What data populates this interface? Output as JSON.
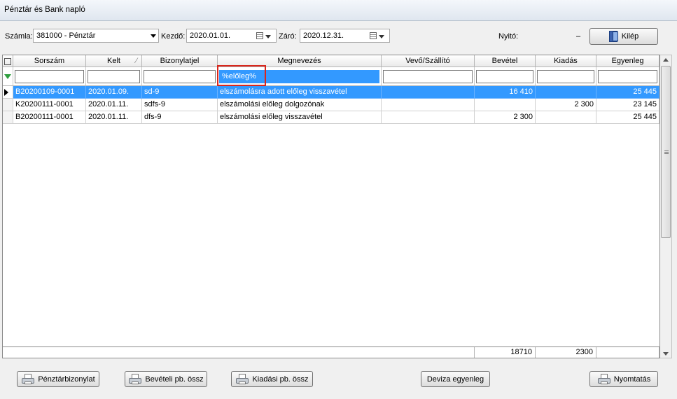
{
  "window": {
    "title": "Pénztár és Bank napló"
  },
  "toolbar": {
    "szamla_label": "Számla:",
    "szamla_value": "381000 - Pénztár",
    "kezdo_label": "Kezdő:",
    "kezdo_value": "2020.01.01.",
    "zaro_label": "Záró:",
    "zaro_value": "2020.12.31.",
    "nyito_label": "Nyitó:",
    "nyito_value": "–",
    "exit_label": "Kilép"
  },
  "grid": {
    "columns": [
      "Sorszám",
      "Kelt",
      "Bizonylatjel",
      "Megnevezés",
      "Vevő/Szállító",
      "Bevétel",
      "Kiadás",
      "Egyenleg"
    ],
    "filters": [
      "",
      "",
      "",
      "%előleg%",
      "",
      "",
      "",
      ""
    ],
    "rows": [
      [
        "B20200109-0001",
        "2020.01.09.",
        "sd-9",
        "elszámolásra adott előleg visszavétel",
        "",
        "16 410",
        "",
        "25 445"
      ],
      [
        "K20200111-0001",
        "2020.01.11.",
        "sdfs-9",
        "elszámolási előleg dolgozónak",
        "",
        "",
        "2 300",
        "23 145"
      ],
      [
        "B20200111-0001",
        "2020.01.11.",
        "dfs-9",
        "elszámolási előleg visszavétel",
        "",
        "2 300",
        "",
        "25 445"
      ]
    ],
    "totals": {
      "bevetel": "18710",
      "kiadas": "2300"
    }
  },
  "buttons": {
    "penztar": "Pénztárbizonylat",
    "beveteli": "Bevételi pb. össz",
    "kiadasi": "Kiadási pb. össz",
    "deviza": "Deviza egyenleg",
    "nyomtatas": "Nyomtatás"
  },
  "colors": {
    "selection": "#3399ff",
    "highlight_box": "#d9261c"
  }
}
